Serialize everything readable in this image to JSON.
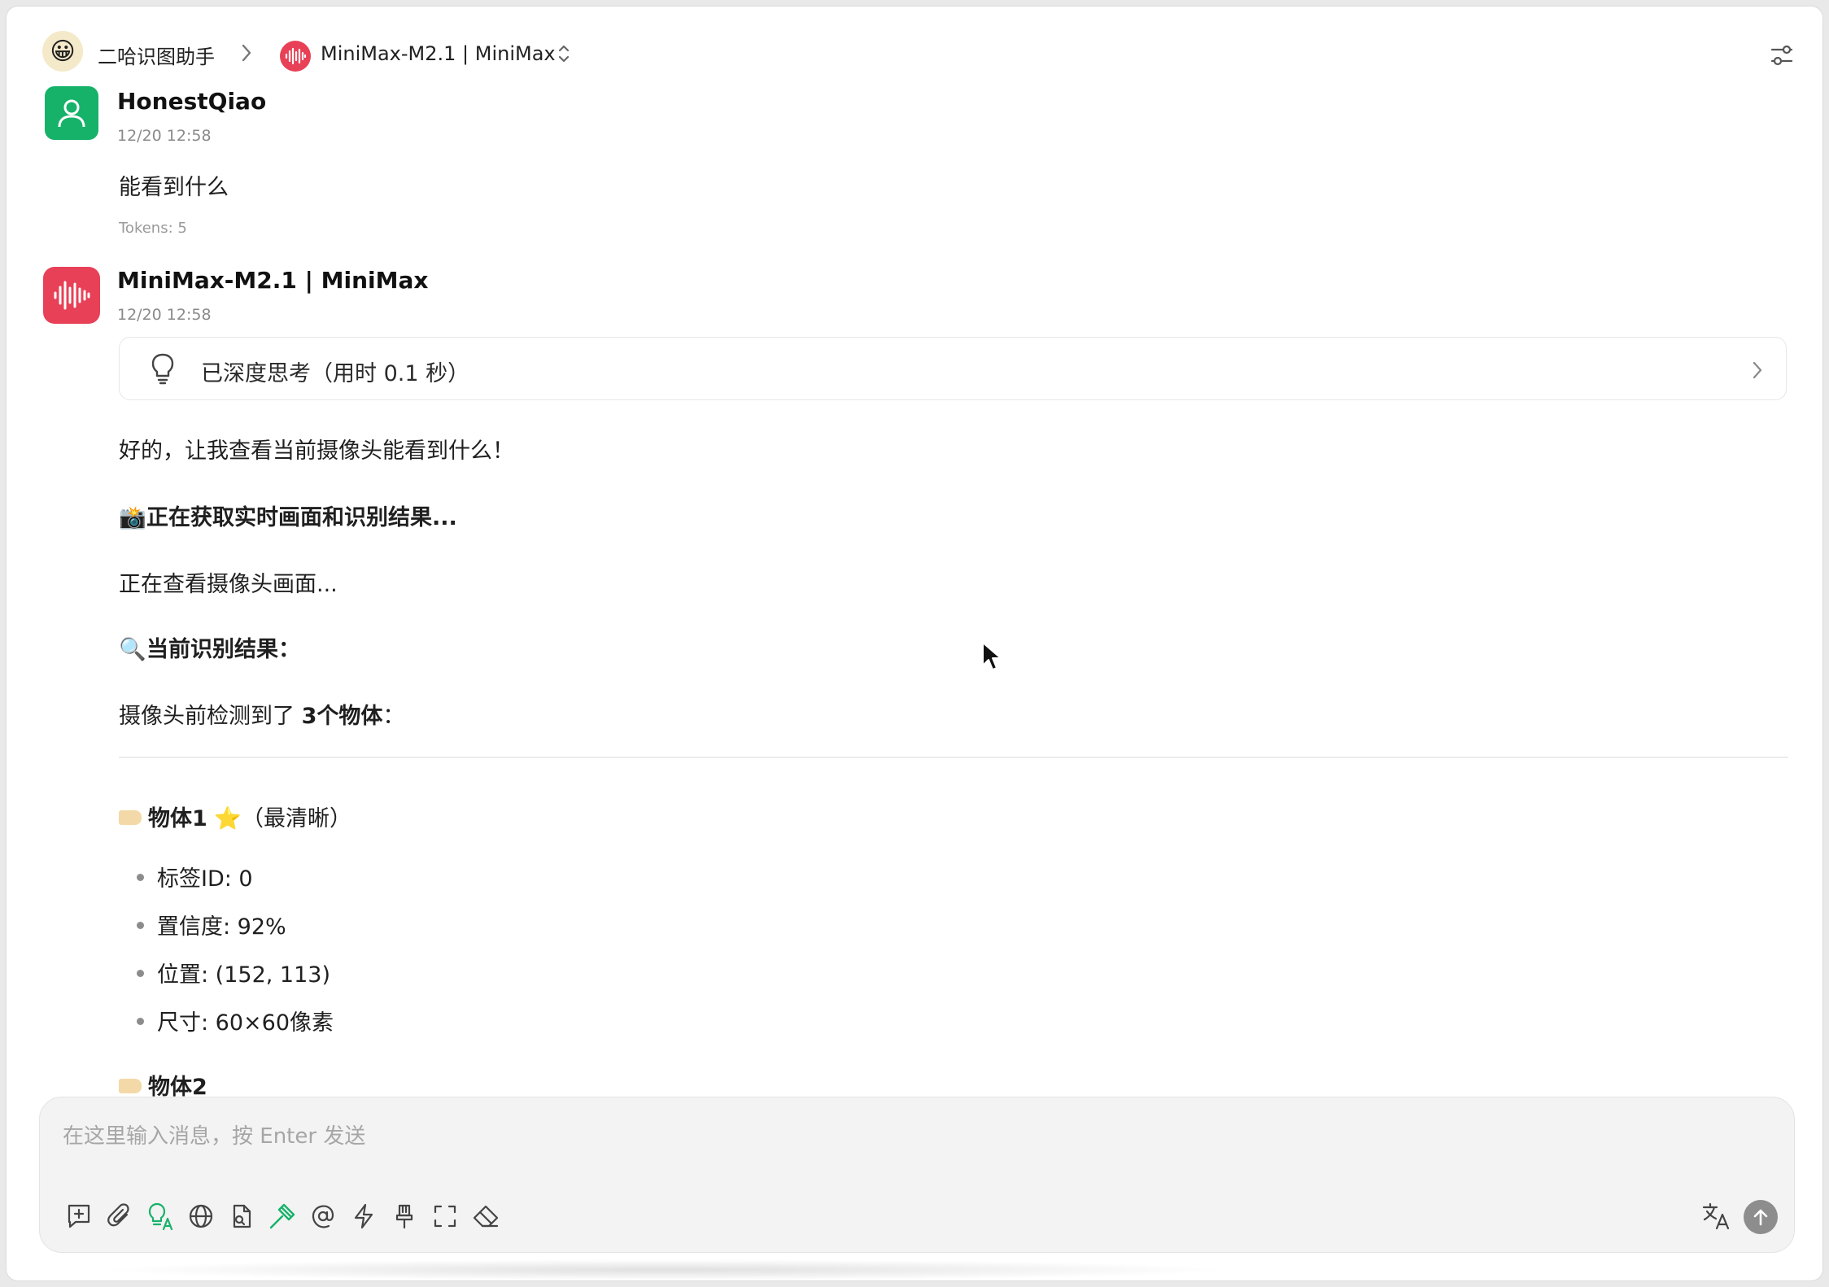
{
  "header": {
    "assistant_name": "二哈识图助手",
    "assistant_emoji": "😀",
    "model_name": "MiniMax-M2.1 | MiniMax"
  },
  "messages": {
    "user": {
      "author": "HonestQiao",
      "time": "12/20 12:58",
      "text": "能看到什么",
      "tokens": "Tokens: 5"
    },
    "bot": {
      "author": "MiniMax-M2.1 | MiniMax",
      "time": "12/20 12:58",
      "thinking_label": "已深度思考（用时 0.1 秒）",
      "intro": "好的，让我查看当前摄像头能看到什么！",
      "fetching_emoji": "📸",
      "fetching": "正在获取实时画面和识别结果...",
      "viewing": "正在查看摄像头画面...",
      "result_emoji": "🔍",
      "result_heading": "当前识别结果：",
      "detected_prefix": "摄像头前检测到了 ",
      "detected_bold": "3个物体",
      "detected_suffix": "：",
      "object1_title": "物体1",
      "object1_star": "⭐",
      "object1_note": "（最清晰）",
      "object1_props": [
        "标签ID: 0",
        "置信度: 92%",
        "位置: (152, 113)",
        "尺寸: 60×60像素"
      ],
      "object2_title": "物体2"
    }
  },
  "composer": {
    "placeholder": "在这里输入消息，按 Enter 发送",
    "tools": [
      "new-topic-icon",
      "attachment-icon",
      "reasoning-icon",
      "web-search-icon",
      "knowledge-icon",
      "mcp-tools-icon",
      "mention-icon",
      "quick-phrase-icon",
      "pin-icon",
      "fullscreen-icon",
      "clear-icon"
    ],
    "accent_color": "#17b26a"
  },
  "colors": {
    "user_avatar": "#17b26a",
    "model_avatar": "#e84057"
  }
}
